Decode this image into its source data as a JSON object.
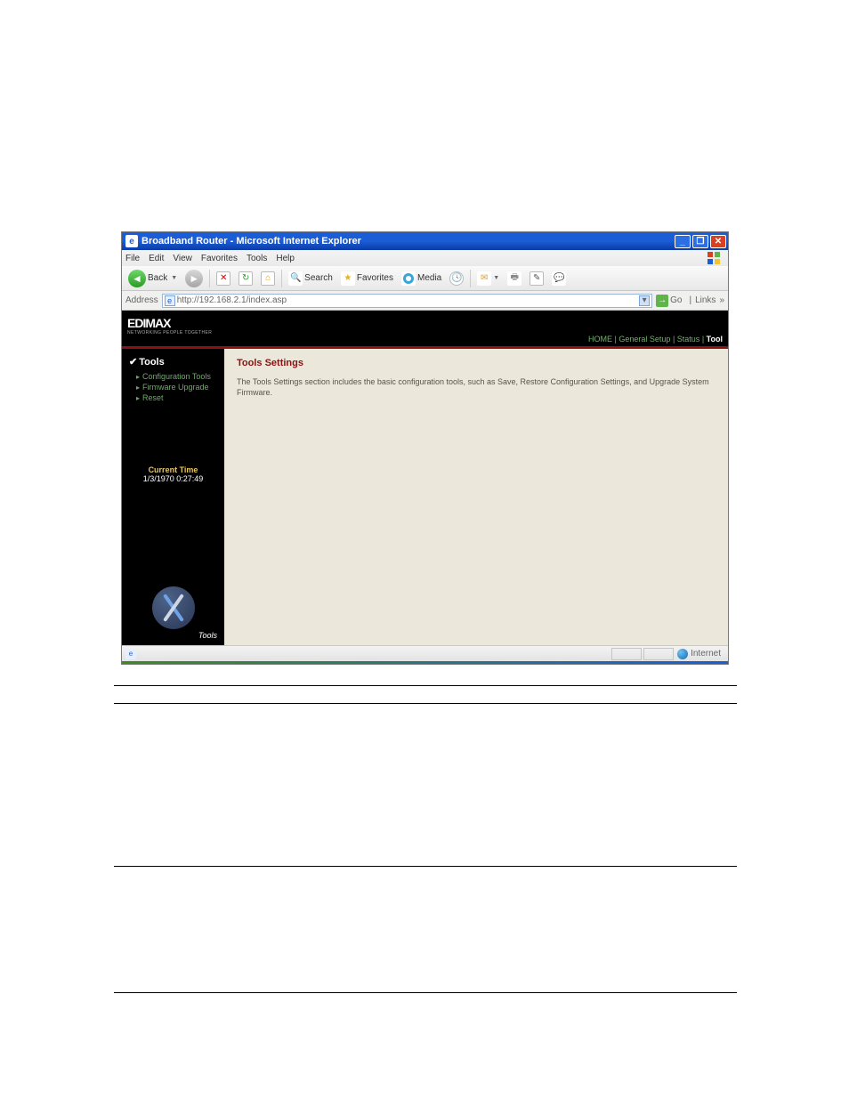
{
  "window": {
    "title": "Broadband Router - Microsoft Internet Explorer"
  },
  "menubar": [
    "File",
    "Edit",
    "View",
    "Favorites",
    "Tools",
    "Help"
  ],
  "toolbar": {
    "back": "Back",
    "search": "Search",
    "favorites": "Favorites",
    "media": "Media"
  },
  "addressbar": {
    "label": "Address",
    "url": "http://192.168.2.1/index.asp",
    "go": "Go",
    "links": "Links"
  },
  "brand": {
    "name": "EDIMAX",
    "tagline": "NETWORKING PEOPLE TOGETHER"
  },
  "toplinks": {
    "home": "HOME",
    "general": "General Setup",
    "status": "Status",
    "tool": "Tool"
  },
  "sidebar": {
    "title": "Tools",
    "items": [
      {
        "label": "Configuration Tools"
      },
      {
        "label": "Firmware Upgrade"
      },
      {
        "label": "Reset"
      }
    ],
    "current_time_label": "Current Time",
    "current_time_value": "1/3/1970 0:27:49",
    "foot_label": "Tools"
  },
  "main": {
    "heading": "Tools Settings",
    "body": "The Tools Settings section includes the basic configuration tools, such as Save, Restore Configuration Settings, and Upgrade System Firmware."
  },
  "statusbar": {
    "zone": "Internet"
  }
}
